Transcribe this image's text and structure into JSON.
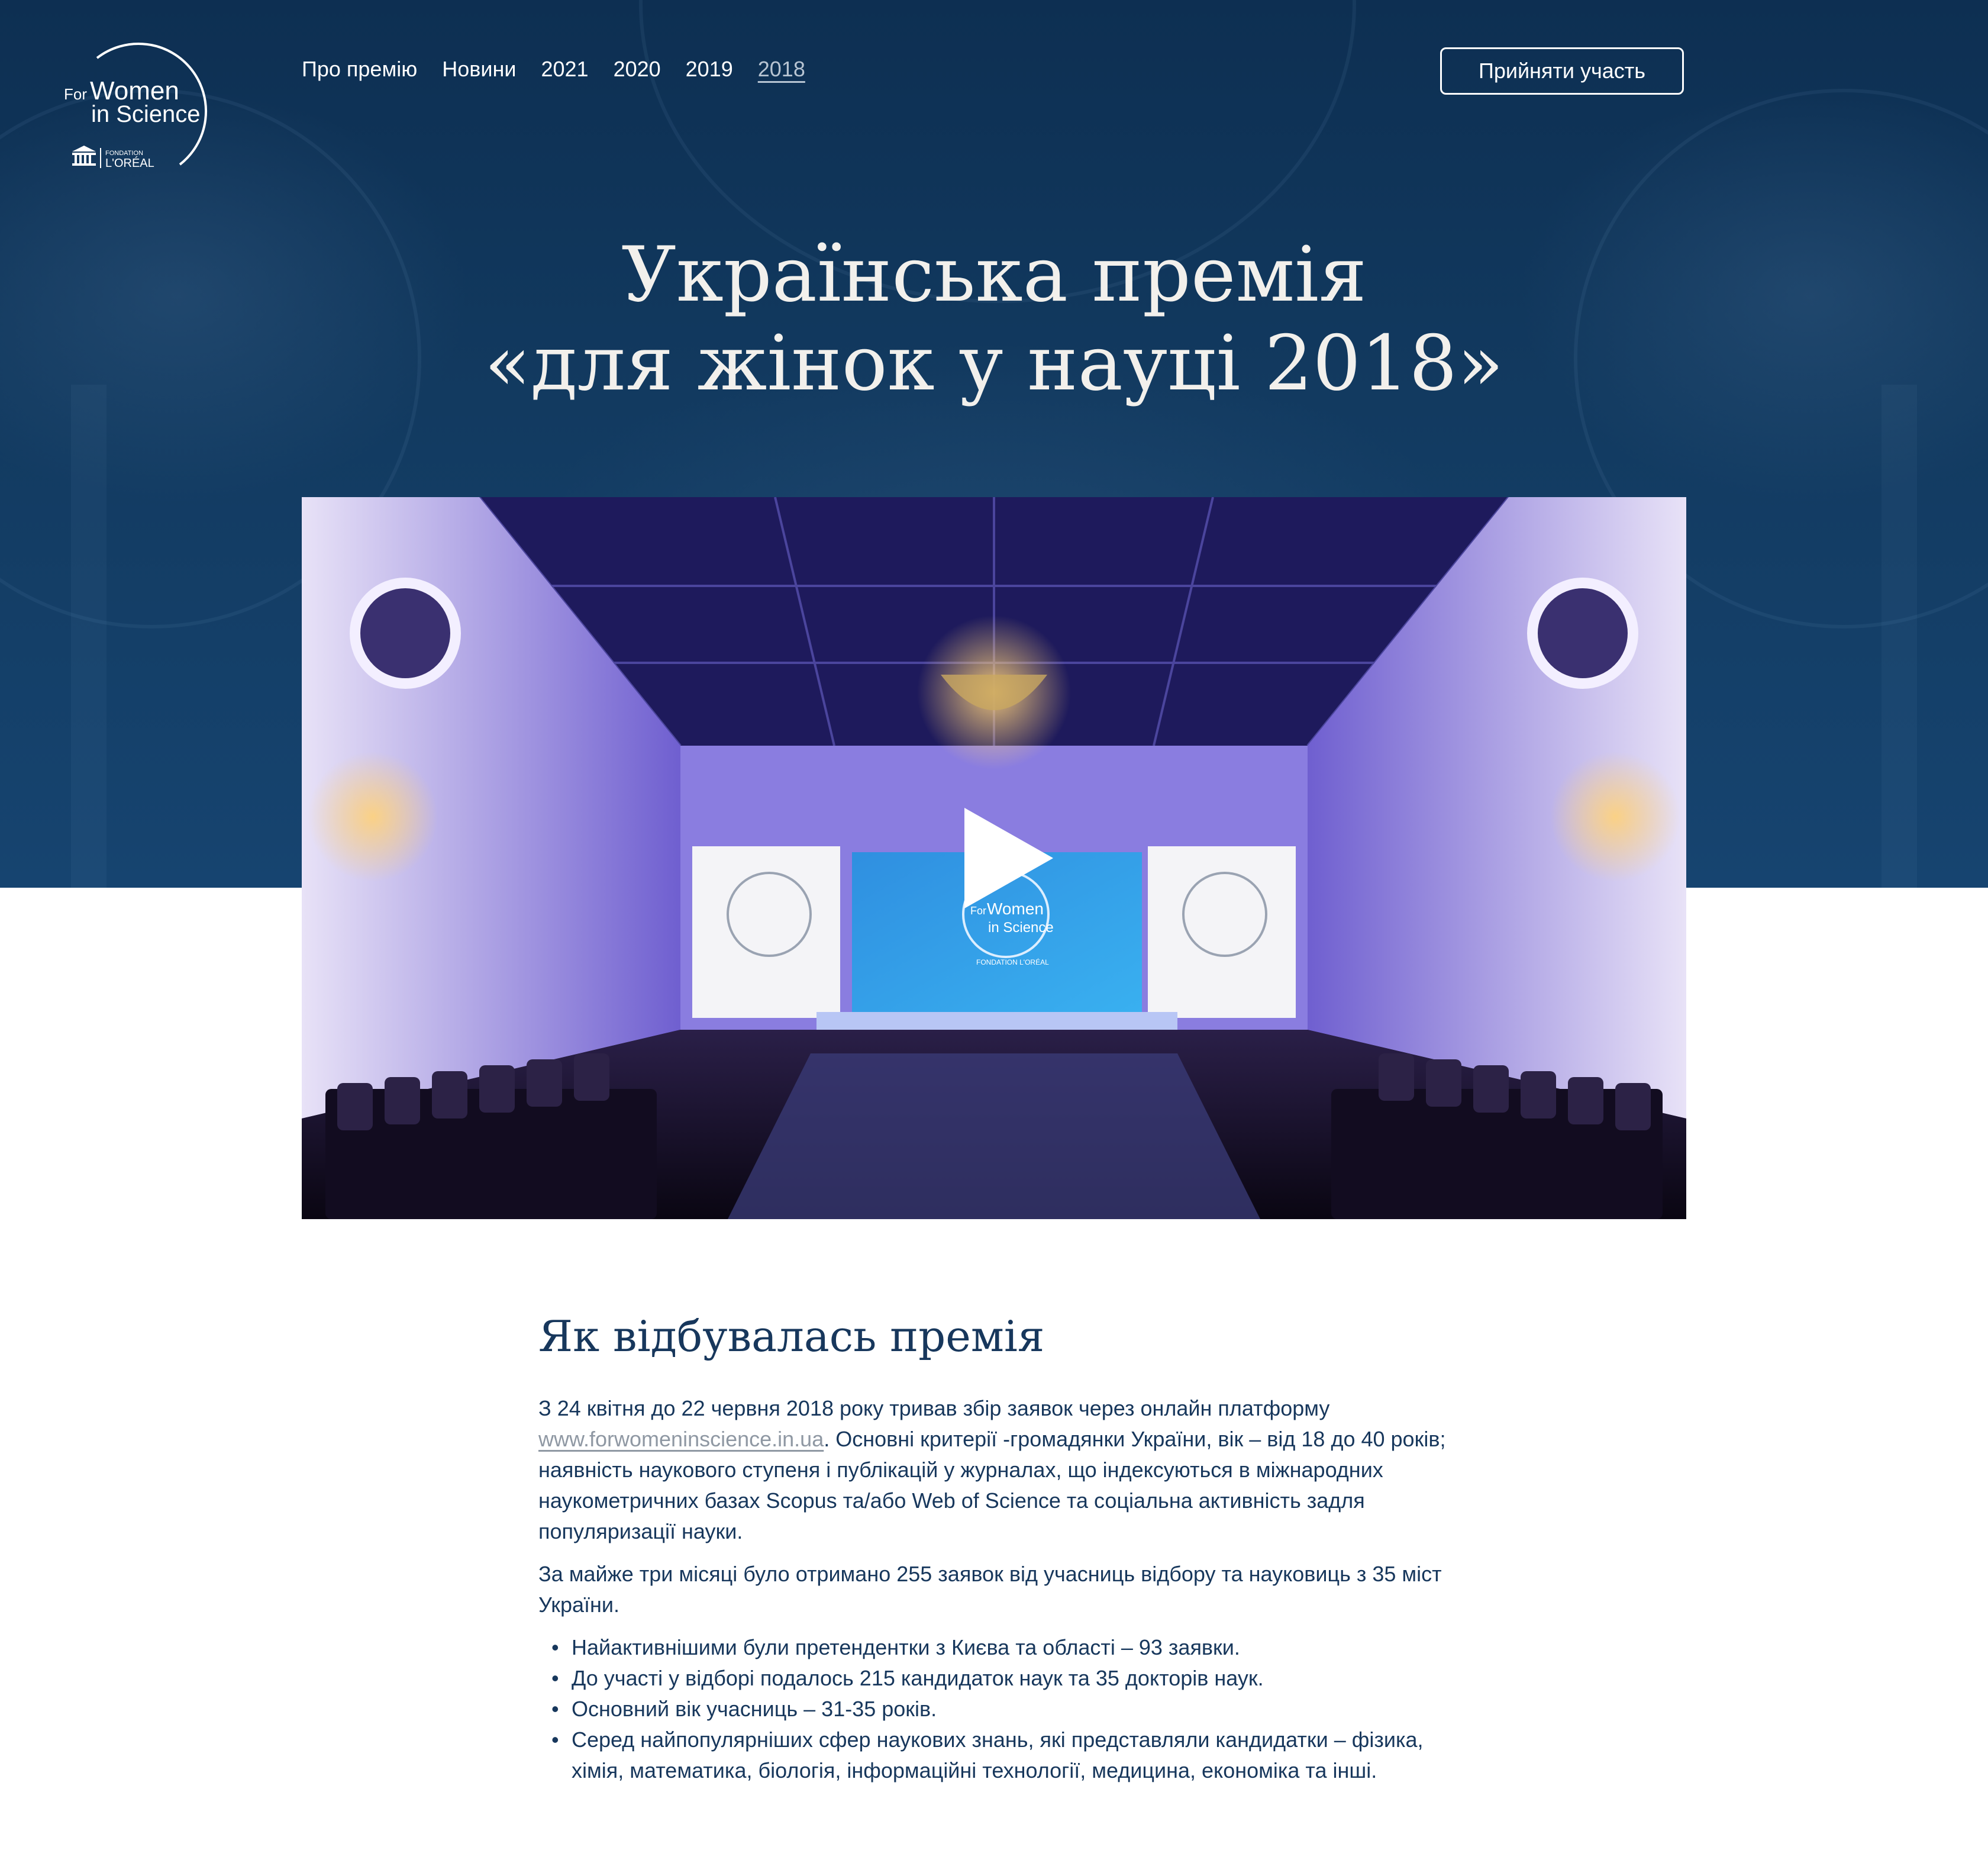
{
  "header": {
    "logo": {
      "line1": "For",
      "line2": "Women",
      "line3": "in Science",
      "sub1": "FONDATION",
      "sub2": "L'ORÉAL"
    },
    "nav": [
      {
        "label": "Про премію"
      },
      {
        "label": "Новини"
      },
      {
        "label": "2021"
      },
      {
        "label": "2020"
      },
      {
        "label": "2019"
      },
      {
        "label": "2018",
        "active": true
      }
    ],
    "cta_label": "Прийняти участь"
  },
  "hero": {
    "title_line1": "Українська премія",
    "title_line2": "«для жінок у науці 2018»"
  },
  "video": {
    "play_icon": "play-icon",
    "screen_logo_line1": "For",
    "screen_logo_line2": "Women",
    "screen_logo_line3": "in Science",
    "screen_logo_sub": "FONDATION L'ORÉAL"
  },
  "content": {
    "heading": "Як відбувалась премія",
    "p1_before_link": "З 24 квітня до 22 червня 2018 року тривав збір заявок через онлайн платформу ",
    "p1_link": "www.forwomeninscience.in.ua",
    "p1_after_link": ". Основні критерії -громадянки України, вік – від 18 до 40 років; наявність наукового ступеня і публікацій у журналах, що індексуються в міжнародних наукометричних базах Scopus та/або Web of Science та соціальна активність задля популяризації науки.",
    "p2": "За майже три місяці було отримано 255 заявок від учасниць відбору та науковиць з 35 міст України.",
    "bullets": [
      "Найактивнішими були претендентки з Києва та області – 93 заявки.",
      "До участі у відборі подалось 215 кандидаток наук та 35 докторів наук.",
      "Основний вік учасниць – 31-35 років.",
      "Серед найпопулярніших сфер наукових знань, які представляли кандидатки – фізика, хімія, математика, біологія, інформаційні технології, медицина, економіка та інші."
    ],
    "bullet_char": "•"
  },
  "colors": {
    "hero_bg": "#123a60",
    "text_primary": "#17375c",
    "link": "#8f98a3",
    "white": "#ffffff"
  }
}
